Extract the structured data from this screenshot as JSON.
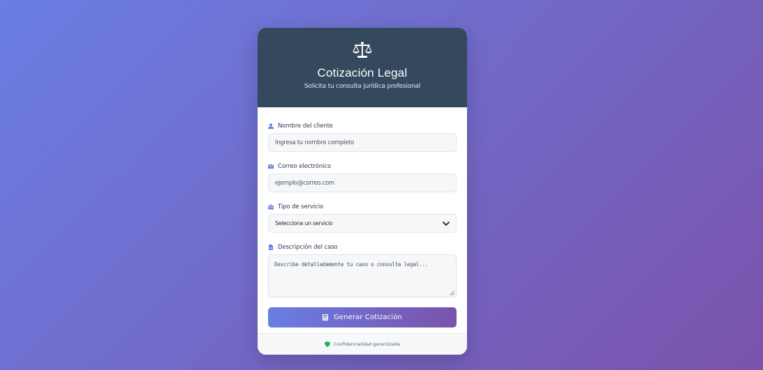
{
  "header": {
    "logo_icon": "scale-balance-icon",
    "title": "Cotización Legal",
    "subtitle": "Solicita tu consulta jurídica profesional"
  },
  "form": {
    "name": {
      "icon": "user-icon",
      "label": "Nombre del cliente",
      "placeholder": "Ingresa tu nombre completo"
    },
    "email": {
      "icon": "envelope-icon",
      "label": "Correo electrónico",
      "placeholder": "ejemplo@correo.com"
    },
    "service": {
      "icon": "briefcase-icon",
      "label": "Tipo de servicio",
      "selected": "Selecciona un servicio"
    },
    "description": {
      "icon": "file-icon",
      "label": "Descripción del caso",
      "placeholder": "Describe detalladamente tu caso o consulta legal..."
    },
    "submit": {
      "icon": "calculator-icon",
      "label": "Generar Cotización"
    }
  },
  "footer": {
    "icon": "shield-icon",
    "text": "Confidencialidad garantizada"
  },
  "colors": {
    "header_bg": "#34495e",
    "accent_start": "#6a7ee3",
    "accent_end": "#7a53ab",
    "icon_accent": "#667eea",
    "shield_green": "#27ae60"
  }
}
